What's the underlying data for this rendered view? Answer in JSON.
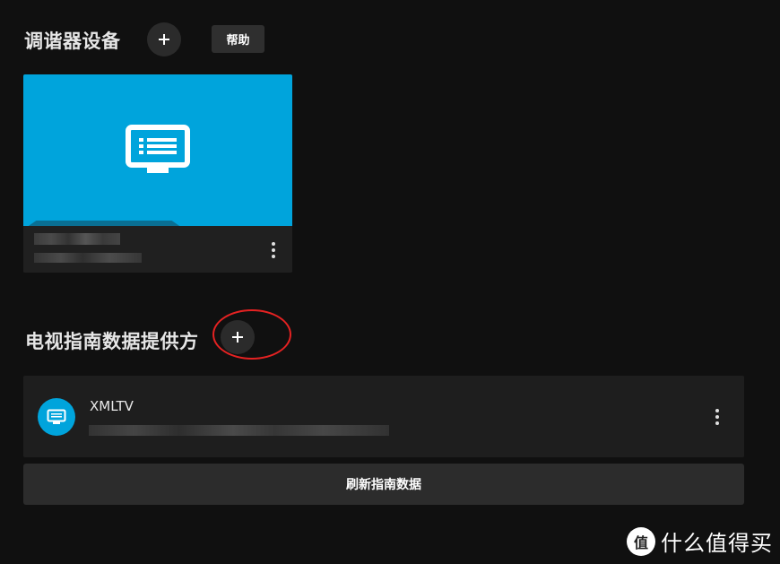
{
  "tuners": {
    "title": "调谐器设备",
    "add_label": "+",
    "help_label": "帮助",
    "card": {
      "icon": "tv-guide-icon",
      "accent": "#00a4dc"
    }
  },
  "guide": {
    "title": "电视指南数据提供方",
    "add_label": "+",
    "provider": {
      "name": "XMLTV",
      "icon": "tv-guide-icon"
    },
    "refresh_label": "刷新指南数据"
  },
  "watermark": {
    "text": "什么值得买",
    "logo_char": "值"
  }
}
